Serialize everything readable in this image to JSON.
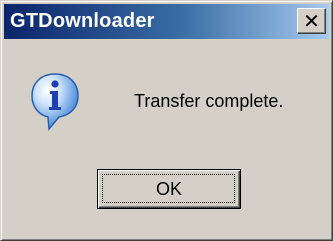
{
  "window": {
    "title": "GTDownloader",
    "close_glyph": "✕"
  },
  "dialog": {
    "icon": "info-icon",
    "message": "Transfer complete.",
    "ok_label": "OK"
  },
  "colors": {
    "titlebar_start": "#0a246a",
    "titlebar_end": "#a6caf0",
    "face": "#d4d0c8",
    "icon_bubble": "#3d7fd6"
  }
}
